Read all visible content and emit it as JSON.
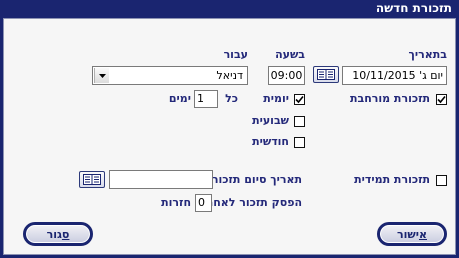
{
  "window": {
    "title": "תזכורת חדשה"
  },
  "labels": {
    "date": "בתאריך",
    "time": "בשעה",
    "for": "עבור",
    "extended": "תזכורת מורחבת",
    "daily": "יומית",
    "every": "כל",
    "days": "ימים",
    "weekly": "שבועית",
    "monthly": "חודשית",
    "permanent": "תזכורת תמידית",
    "end_date": "תאריך סיום תזכור",
    "stop_after": "הפסק תזכור לאחר",
    "repetitions": "חזרות"
  },
  "fields": {
    "date_value": "יום ג' 10/11/2015",
    "time_value": "09:00",
    "user_value": "דניאל",
    "every_days_value": "1",
    "end_date_value": "",
    "stop_after_value": "0"
  },
  "checks": {
    "extended": true,
    "daily": true,
    "weekly": false,
    "monthly": false,
    "permanent": false
  },
  "buttons": {
    "ok_underlined": "א",
    "ok_rest": "ישור",
    "close_underlined": "ס",
    "close_rest": "גור"
  },
  "icons": {
    "calendar": "calendar-icon",
    "dropdown": "dropdown-arrow-icon",
    "check": "checkmark-icon"
  }
}
